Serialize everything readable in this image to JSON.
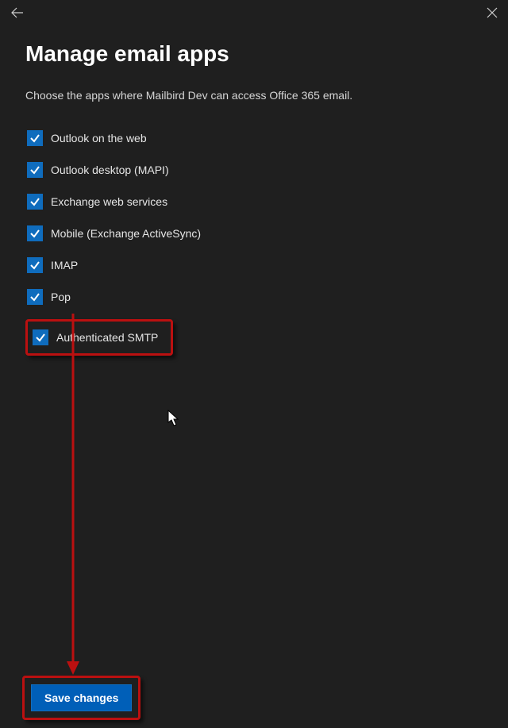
{
  "header": {
    "title": "Manage email apps",
    "description": "Choose the apps where Mailbird Dev can access Office 365 email."
  },
  "options": [
    {
      "label": "Outlook on the web",
      "checked": true,
      "highlight": false
    },
    {
      "label": "Outlook desktop (MAPI)",
      "checked": true,
      "highlight": false
    },
    {
      "label": "Exchange web services",
      "checked": true,
      "highlight": false
    },
    {
      "label": "Mobile (Exchange ActiveSync)",
      "checked": true,
      "highlight": false
    },
    {
      "label": "IMAP",
      "checked": true,
      "highlight": false
    },
    {
      "label": "Pop",
      "checked": true,
      "highlight": false
    },
    {
      "label": "Authenticated SMTP",
      "checked": true,
      "highlight": true
    }
  ],
  "actions": {
    "save_label": "Save changes"
  },
  "colors": {
    "accent": "#0f6cbd",
    "highlight": "#bb1010"
  }
}
